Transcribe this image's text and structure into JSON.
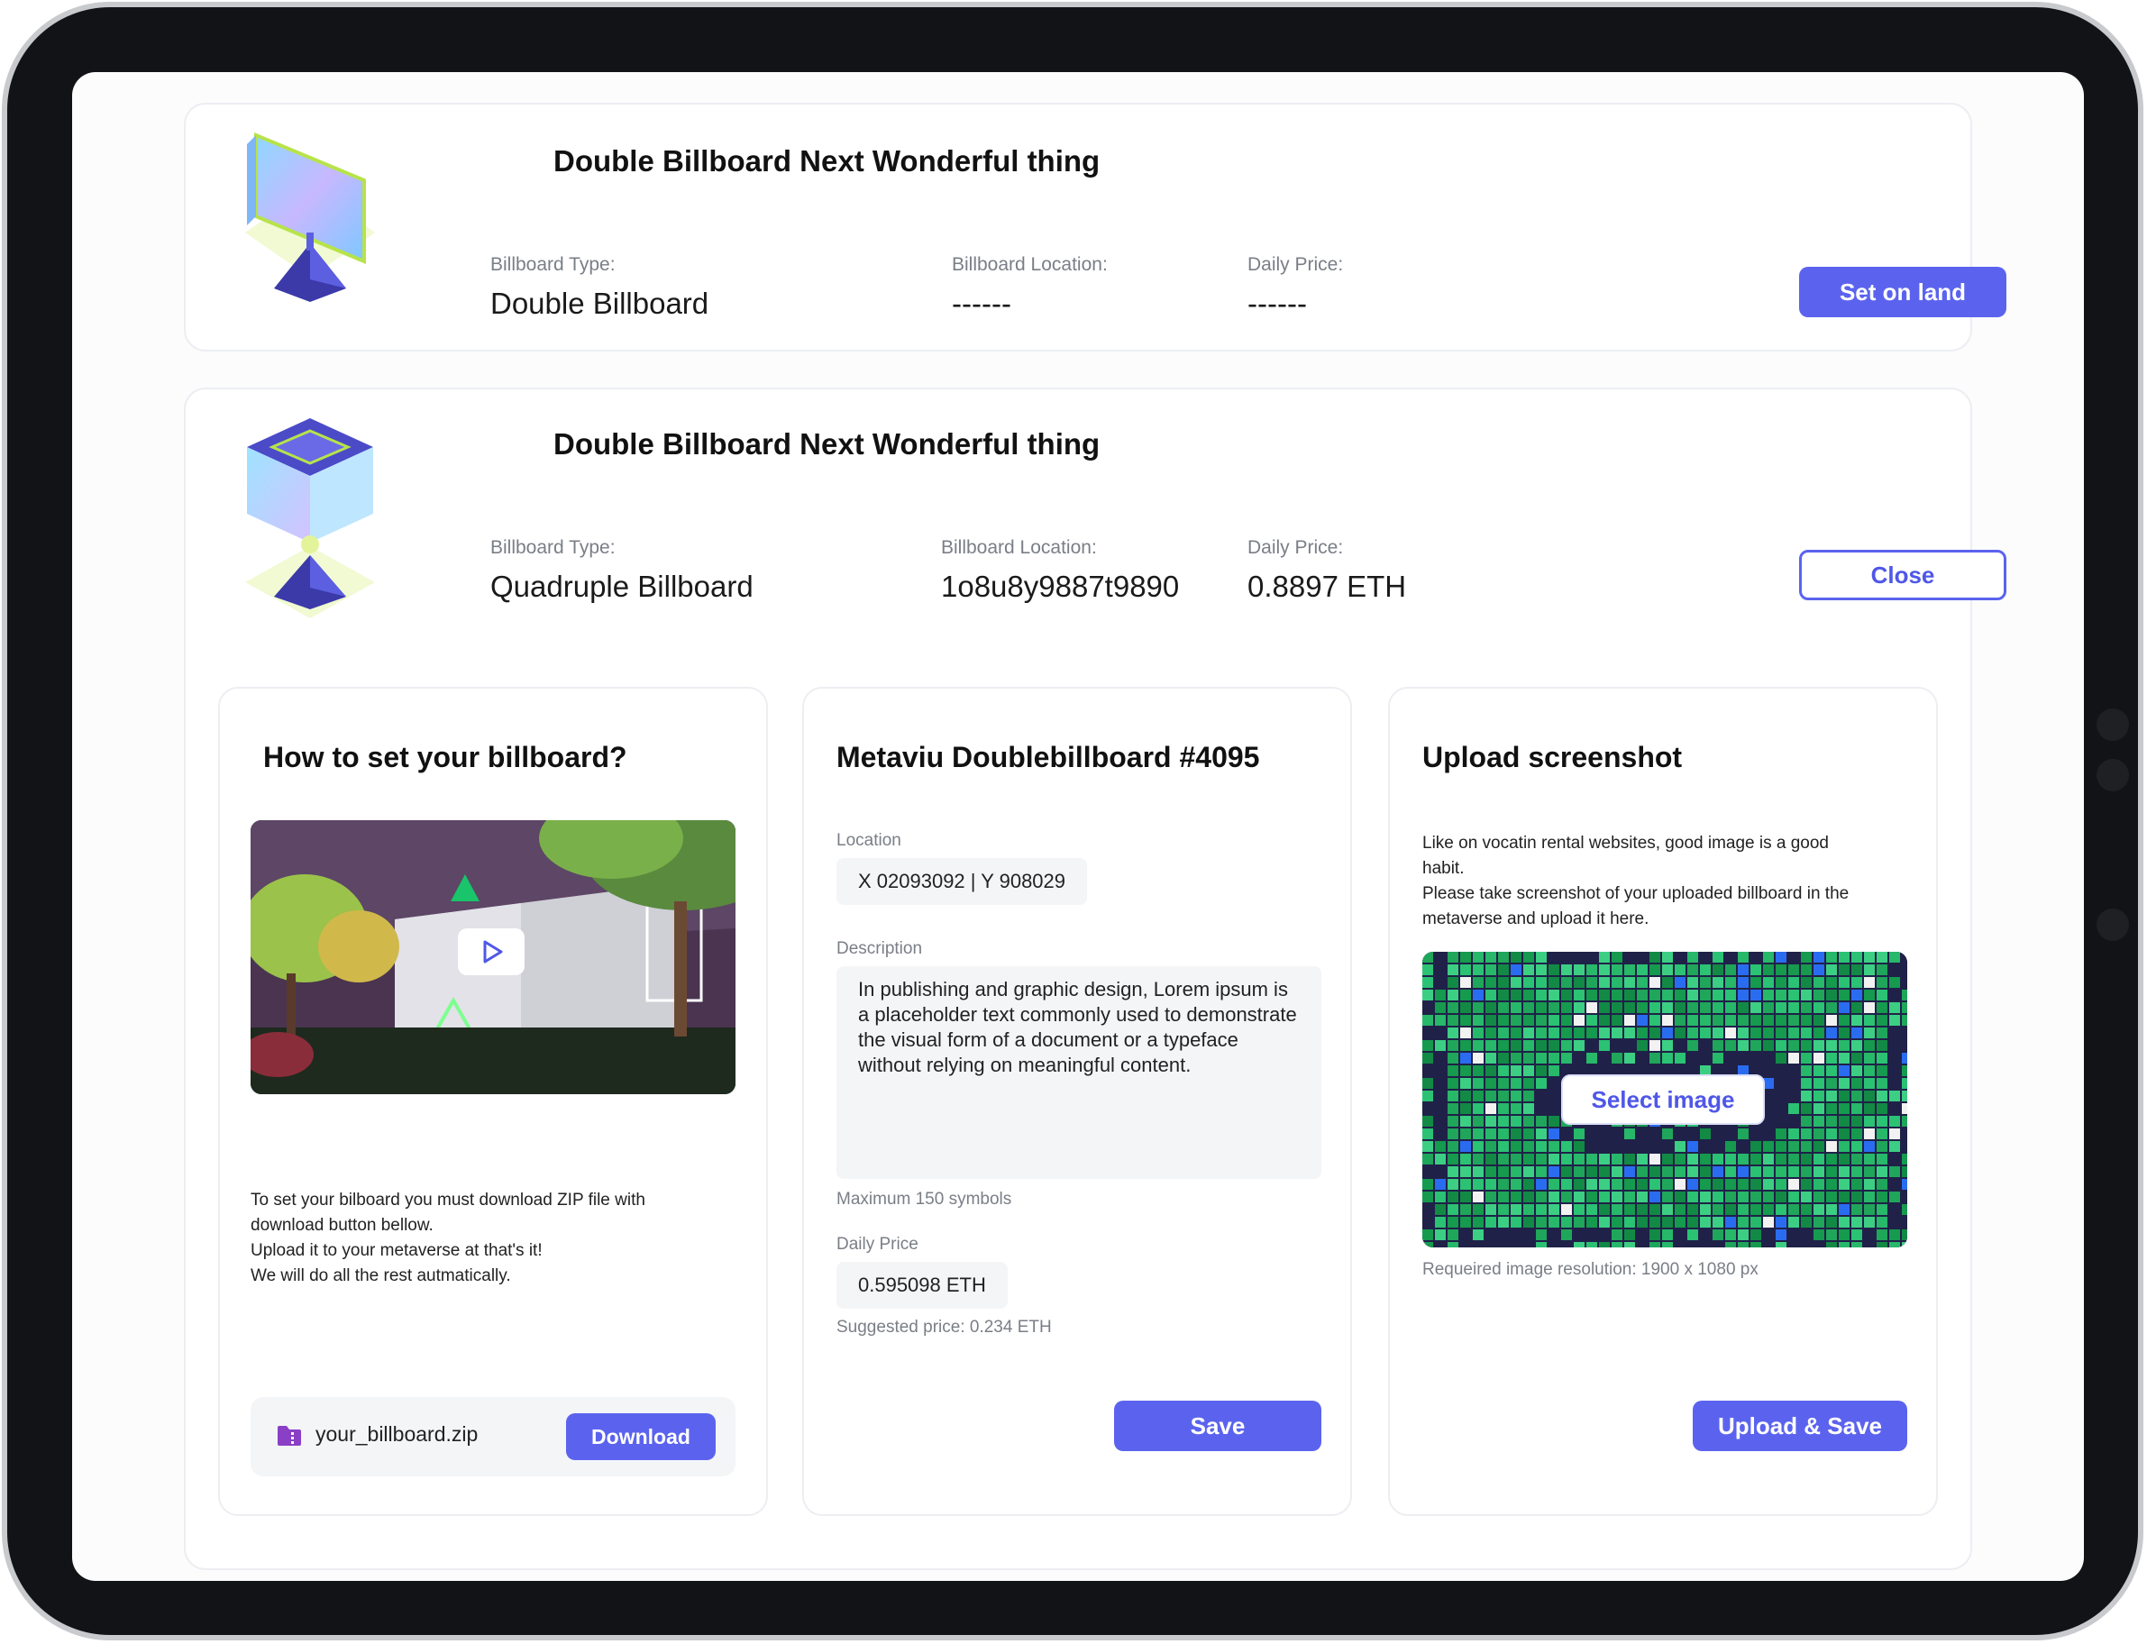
{
  "billboards": [
    {
      "title": "Double Billboard Next Wonderful thing",
      "type_label": "Billboard Type:",
      "type_value": "Double Billboard",
      "location_label": "Billboard Location:",
      "location_value": "------",
      "price_label": "Daily Price:",
      "price_value": "------",
      "action_label": "Set on land"
    },
    {
      "title": "Double Billboard Next Wonderful thing",
      "type_label": "Billboard Type:",
      "type_value": "Quadruple Billboard",
      "location_label": "Billboard Location:",
      "location_value": "1o8u8y9887t9890",
      "price_label": "Daily Price:",
      "price_value": "0.8897 ETH",
      "action_label": "Close"
    }
  ],
  "howto": {
    "title": "How to set your billboard?",
    "lines": [
      "To set your bilboard you must download ZIP file with",
      "download button bellow.",
      "Upload it to your metaverse at that's it!",
      "We will do all the rest autmatically."
    ],
    "file_name": "your_billboard.zip",
    "download_label": "Download",
    "play-icon": "play-icon",
    "file-icon": "zip-file-icon"
  },
  "details": {
    "title": "Metaviu Doublebillboard #4095",
    "location_label": "Location",
    "location_value": "X 02093092 | Y 908029",
    "description_label": "Description",
    "description_value": "In publishing and graphic design, Lorem ipsum is a placeholder text commonly used to demonstrate the visual form of a document or a typeface without relying on meaningful content.",
    "description_hint": "Maximum 150 symbols",
    "price_label": "Daily Price",
    "price_value": "0.595098 ETH",
    "price_hint": "Suggested price: 0.234 ETH",
    "save_label": "Save"
  },
  "upload": {
    "title": "Upload screenshot",
    "lines": [
      "Like on vocatin rental websites, good image is a good",
      "habit.",
      "Please take screenshot of your uploaded billboard in the",
      "metaverse and upload it here."
    ],
    "select_label": "Select image",
    "resolution_hint": "Requeired image resolution: 1900 x 1080 px",
    "save_label": "Upload & Save"
  },
  "colors": {
    "accent": "#5b63ee",
    "frame": "#121316",
    "card_border": "#eceef2"
  }
}
